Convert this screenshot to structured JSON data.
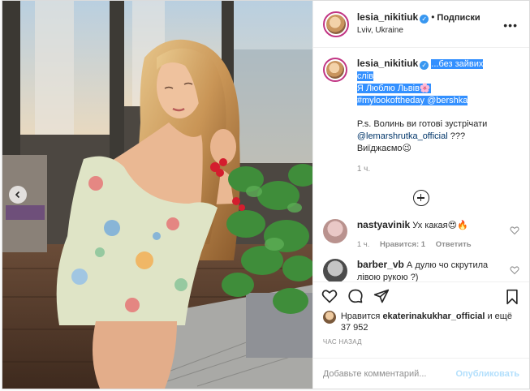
{
  "post": {
    "username": "lesia_nikitiuk",
    "verified_icon": "verified-badge-icon",
    "separator": "•",
    "follow_label": "Подписки",
    "location": "Lviv, Ukraine",
    "more_icon": "more-options-icon"
  },
  "caption": {
    "username": "lesia_nikitiuk",
    "line1_highlight": "без зайвих слів",
    "line2_highlight": "Я Люблю Львів🌸",
    "hashtag": "#mylookoftheday",
    "mention": "@bershka",
    "ps_text": "P.s. Волинь ви готові зустрічати",
    "ps_mention": "@lemarshrutka_official",
    "ps_tail": "???",
    "ps_line3": "Виїджаємо😉",
    "time": "1 ч."
  },
  "comments": [
    {
      "username": "nastyavinik",
      "text": "Ух какая😍🔥",
      "time": "1 ч.",
      "likes": "Нравится: 1",
      "reply": "Ответить"
    },
    {
      "username": "barber_vb",
      "text": "А дулю чо скрутила лівою рукою ?)"
    }
  ],
  "likes": {
    "prefix": "Нравится",
    "user": "ekaterinakukhar_official",
    "suffix": "и ещё 37 952"
  },
  "posted_time": "ЧАС НАЗАД",
  "add_comment": {
    "placeholder": "Добавьте комментарий...",
    "publish": "Опубликовать"
  },
  "colors": {
    "accent": "#3897f0",
    "highlight": "#3390ff",
    "link": "#003569",
    "publish_disabled": "#b2dffc"
  }
}
